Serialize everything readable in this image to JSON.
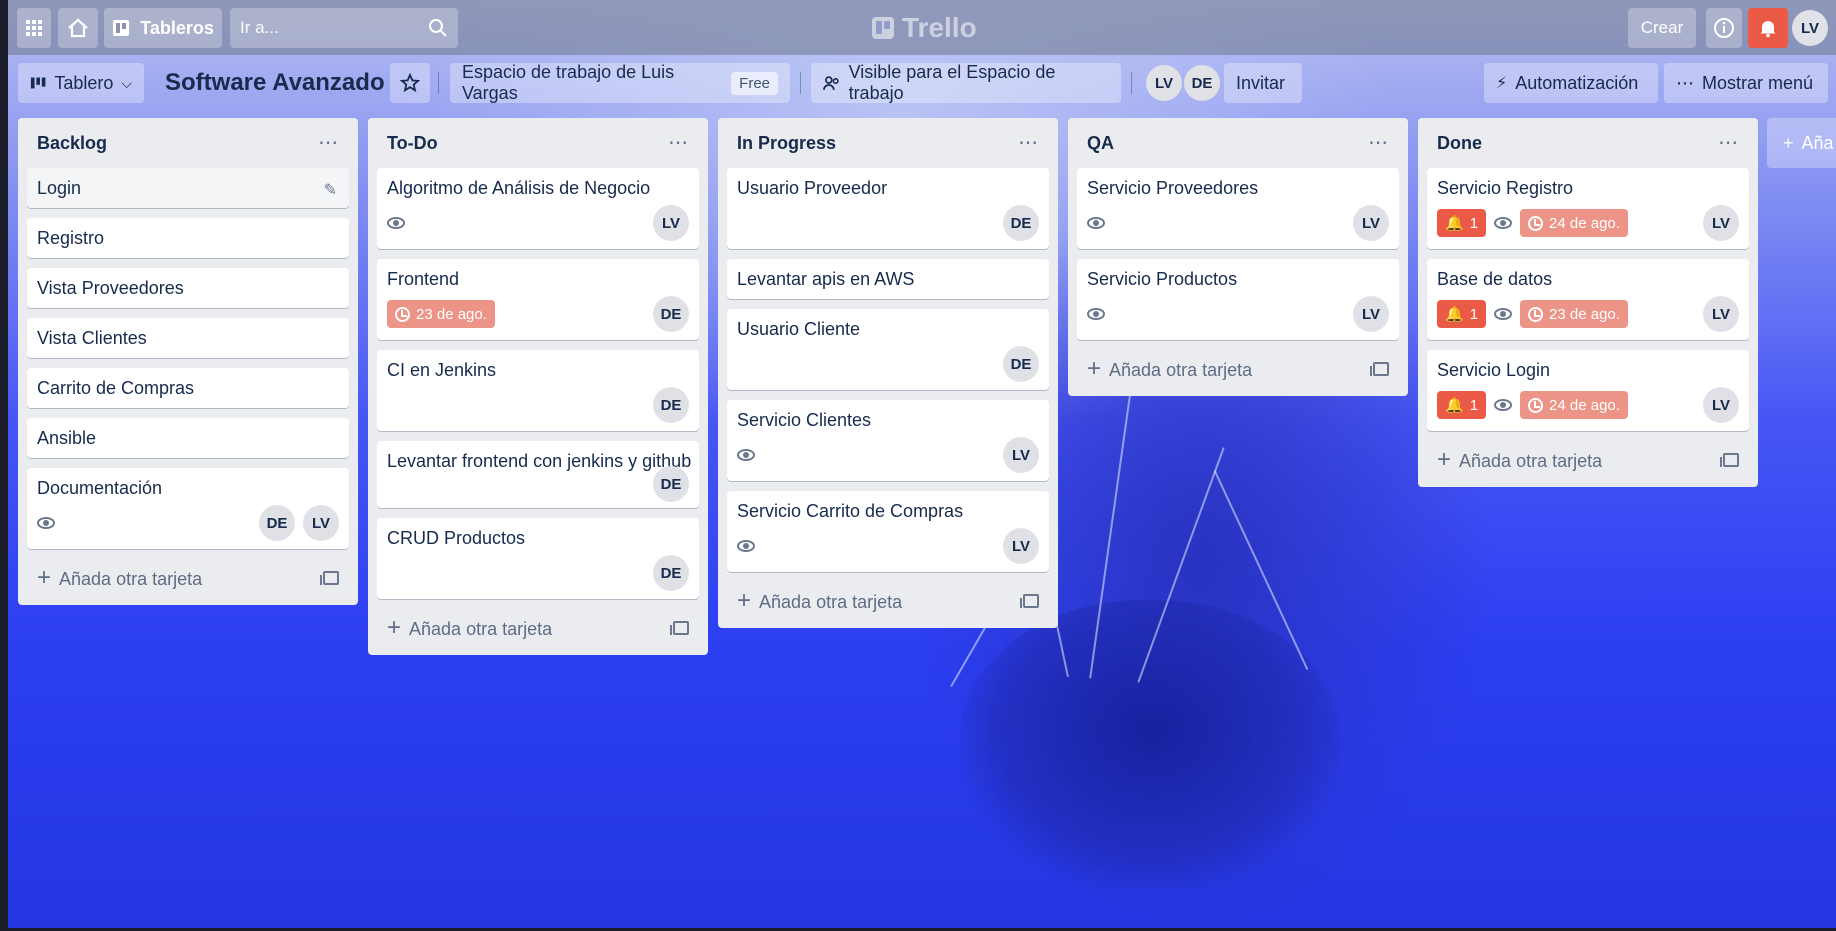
{
  "topbar": {
    "boards_label": "Tableros",
    "search_placeholder": "Ir a...",
    "logo_text": "Trello",
    "create_label": "Crear",
    "user_initials": "LV"
  },
  "board": {
    "view_label": "Tablero",
    "title": "Software Avanzado",
    "workspace_label": "Espacio de trabajo de Luis Vargas",
    "workspace_plan": "Free",
    "visibility_label": "Visible para el Espacio de trabajo",
    "members": [
      "LV",
      "DE"
    ],
    "invite_label": "Invitar",
    "automation_label": "Automatización",
    "menu_label": "Mostrar menú",
    "add_list_label": "Aña"
  },
  "add_card_label": "Añada otra tarjeta",
  "colors": {
    "label_red": "#eb5a46",
    "due_overdue": "#ec9488",
    "list_bg": "#ebecf0"
  },
  "lists": [
    {
      "title": "Backlog",
      "cards": [
        {
          "title": "Login",
          "editing": true
        },
        {
          "title": "Registro"
        },
        {
          "title": "Vista Proveedores"
        },
        {
          "title": "Vista Clientes"
        },
        {
          "title": "Carrito de Compras"
        },
        {
          "title": "Ansible"
        },
        {
          "title": "Documentación",
          "watch": true,
          "members": [
            "DE",
            "LV"
          ]
        }
      ]
    },
    {
      "title": "To-Do",
      "cards": [
        {
          "title": "Algoritmo de Análisis de Negocio",
          "watch": true,
          "members": [
            "LV"
          ]
        },
        {
          "title": "Frontend",
          "due": "23 de ago.",
          "members": [
            "DE"
          ]
        },
        {
          "title": "CI en Jenkins",
          "members": [
            "DE"
          ]
        },
        {
          "title": "Levantar frontend con jenkins y github",
          "members": [
            "DE"
          ]
        },
        {
          "title": "CRUD Productos",
          "members": [
            "DE"
          ]
        }
      ]
    },
    {
      "title": "In Progress",
      "cards": [
        {
          "title": "Usuario Proveedor",
          "members": [
            "DE"
          ]
        },
        {
          "title": "Levantar apis en AWS"
        },
        {
          "title": "Usuario Cliente",
          "members": [
            "DE"
          ]
        },
        {
          "title": "Servicio Clientes",
          "watch": true,
          "members": [
            "LV"
          ]
        },
        {
          "title": "Servicio Carrito de Compras",
          "watch": true,
          "members": [
            "LV"
          ]
        }
      ]
    },
    {
      "title": "QA",
      "cards": [
        {
          "title": "Servicio Proveedores",
          "watch": true,
          "members": [
            "LV"
          ]
        },
        {
          "title": "Servicio Productos",
          "watch": true,
          "members": [
            "LV"
          ]
        }
      ]
    },
    {
      "title": "Done",
      "cards": [
        {
          "title": "Servicio Registro",
          "alert": "1",
          "watch": true,
          "due": "24 de ago.",
          "members": [
            "LV"
          ]
        },
        {
          "title": "Base de datos",
          "alert": "1",
          "watch": true,
          "due": "23 de ago.",
          "members": [
            "LV"
          ]
        },
        {
          "title": "Servicio Login",
          "alert": "1",
          "watch": true,
          "due": "24 de ago.",
          "members": [
            "LV"
          ]
        }
      ]
    }
  ]
}
